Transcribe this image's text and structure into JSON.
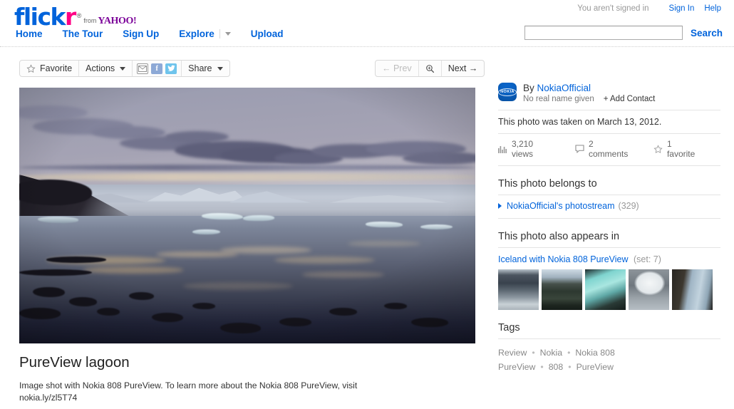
{
  "header": {
    "logo": {
      "part1": "flick",
      "part2": "r",
      "registered": "®",
      "from": "from",
      "yahoo": "YAHOO!"
    },
    "nav": [
      {
        "label": "Home",
        "name": "nav-home"
      },
      {
        "label": "The Tour",
        "name": "nav-the-tour"
      },
      {
        "label": "Sign Up",
        "name": "nav-sign-up"
      },
      {
        "label": "Explore",
        "name": "nav-explore",
        "has_caret": true
      },
      {
        "label": "Upload",
        "name": "nav-upload"
      }
    ],
    "account": {
      "status": "You aren't signed in",
      "sign_in": "Sign In",
      "help": "Help"
    },
    "search": {
      "value": "",
      "placeholder": "",
      "button": "Search"
    }
  },
  "toolbar": {
    "favorite": "Favorite",
    "actions": "Actions",
    "share": "Share",
    "email_icon": "✉",
    "facebook_icon": "f",
    "twitter_icon": "t",
    "prev": "← Prev",
    "prev_disabled": true,
    "next": "Next →",
    "zoom_icon": "magnifier-icon"
  },
  "photo": {
    "title": "PureView lagoon",
    "description": "Image shot with Nokia 808 PureView. To learn more about the Nokia 808 PureView, visit nokia.ly/zl5T74",
    "alt": "Glacier lagoon at sunset with icebergs and snowy mountains"
  },
  "sidebar": {
    "owner": {
      "by": "By",
      "username": "NokiaOfficial",
      "real_name": "No real name given",
      "add_contact": "+ Add Contact",
      "avatar_text": "NOKIA"
    },
    "taken_on": "This photo was taken on March 13, 2012.",
    "stats": [
      {
        "icon": "bar-chart-icon",
        "label": "3,210 views"
      },
      {
        "icon": "comment-icon",
        "label": "2 comments"
      },
      {
        "icon": "star-icon",
        "label": "1 favorite"
      }
    ],
    "belongs_to": {
      "heading": "This photo belongs to",
      "stream_label": "NokiaOfficial's photostream",
      "stream_count": "(329)"
    },
    "appears_in": {
      "heading": "This photo also appears in",
      "set_label": "Iceland with Nokia 808 PureView",
      "set_count": "(set: 7)",
      "thumbnails": [
        {
          "name": "thumbnail-clouds-aerial"
        },
        {
          "name": "thumbnail-moss-landscape"
        },
        {
          "name": "thumbnail-blue-ice"
        },
        {
          "name": "thumbnail-ice-cave"
        },
        {
          "name": "thumbnail-basalt-cliffs"
        }
      ]
    },
    "tags": {
      "heading": "Tags",
      "items": [
        "Review",
        "Nokia",
        "Nokia 808 PureView",
        "808",
        "PureView"
      ],
      "separator": "•"
    }
  },
  "colors": {
    "link_blue": "#0063DB",
    "logo_pink": "#FF0084",
    "yahoo_purple": "#7B0099",
    "muted_grey": "#999999"
  }
}
